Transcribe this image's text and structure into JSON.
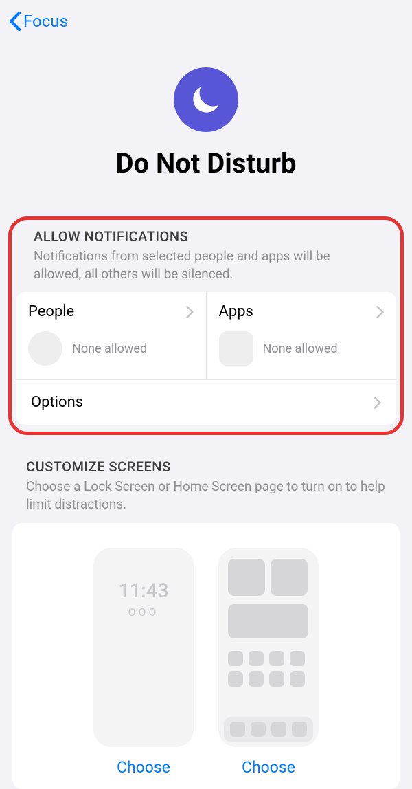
{
  "nav": {
    "back_label": "Focus"
  },
  "header": {
    "title": "Do Not Disturb"
  },
  "notifications": {
    "section_label": "ALLOW NOTIFICATIONS",
    "section_description": "Notifications from selected people and apps will be allowed, all others will be silenced.",
    "people": {
      "title": "People",
      "status": "None allowed"
    },
    "apps": {
      "title": "Apps",
      "status": "None allowed"
    },
    "options_label": "Options"
  },
  "customize": {
    "section_label": "CUSTOMIZE SCREENS",
    "section_description": "Choose a Lock Screen or Home Screen page to turn on to help limit distractions.",
    "lock_time": "11:43",
    "lock_dots": "OOO",
    "choose_lock": "Choose",
    "choose_home": "Choose"
  }
}
